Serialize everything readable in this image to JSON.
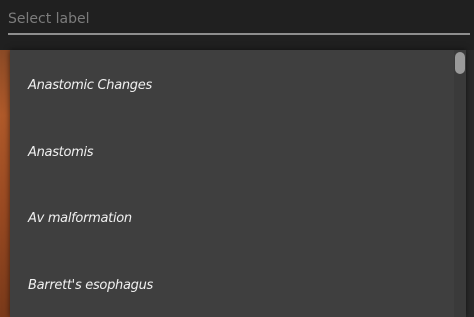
{
  "search": {
    "placeholder": "Select label",
    "value": ""
  },
  "dropdown": {
    "options": [
      "Anastomic Changes",
      "Anastomis",
      "Av malformation",
      "Barrett's esophagus"
    ]
  }
}
